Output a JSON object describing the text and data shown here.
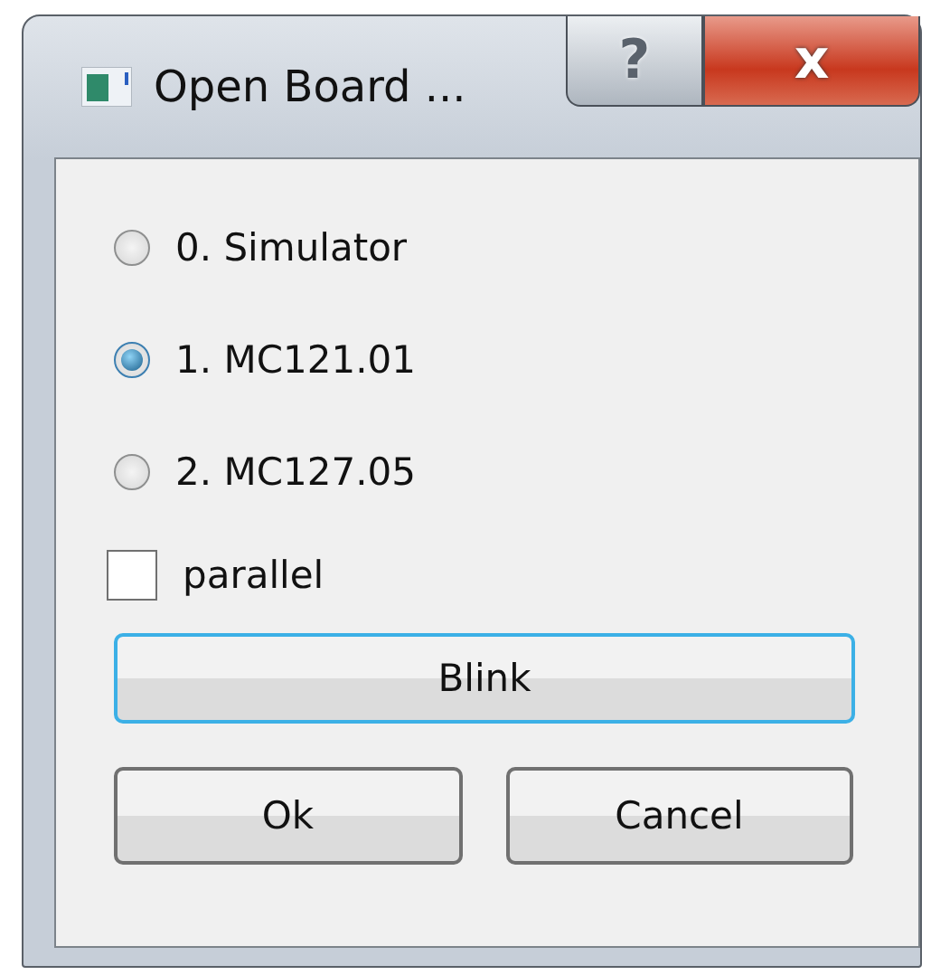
{
  "window": {
    "title": "Open Board ..."
  },
  "title_buttons": [
    {
      "kind": "help",
      "label": "?"
    },
    {
      "kind": "close",
      "label": "x"
    }
  ],
  "options": [
    {
      "label": "0. Simulator",
      "selected": false
    },
    {
      "label": "1. MC121.01",
      "selected": true
    },
    {
      "label": "2. MC127.05",
      "selected": false
    }
  ],
  "parallel": {
    "label": "parallel",
    "checked": false
  },
  "blink_button": {
    "label": "Blink"
  },
  "buttons": [
    "Ok",
    "Cancel"
  ]
}
